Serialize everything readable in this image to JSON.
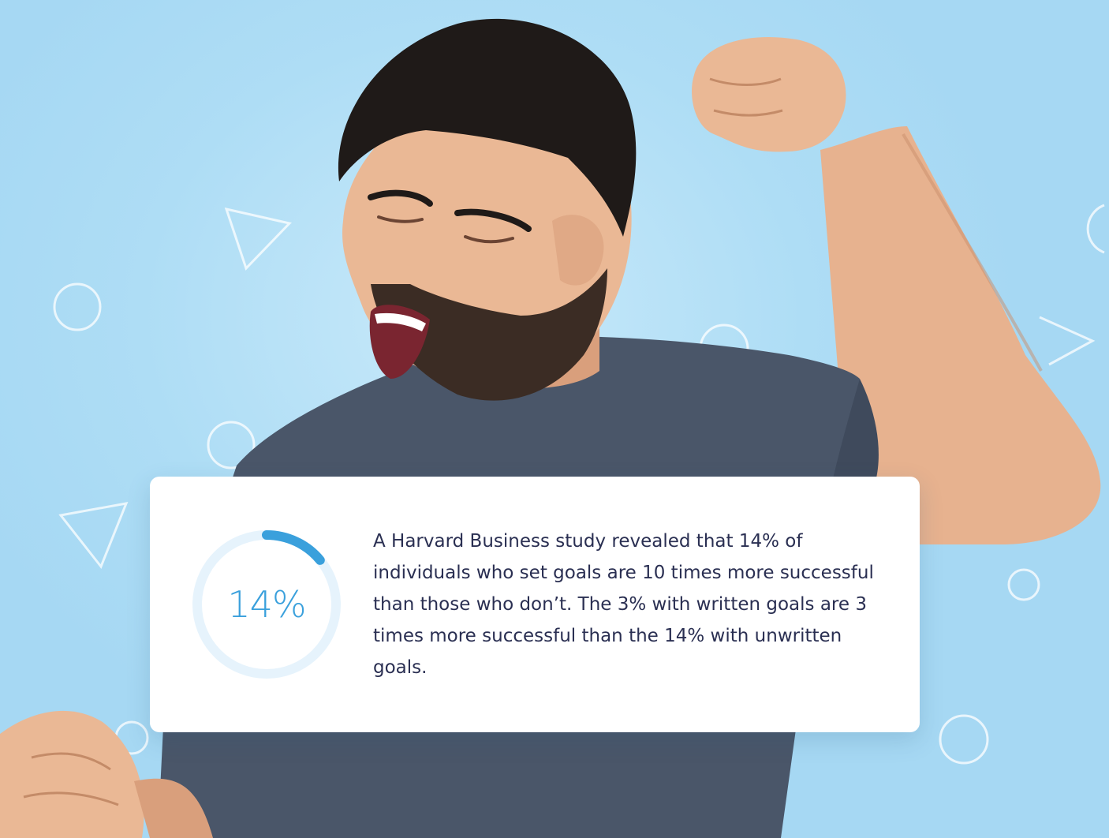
{
  "stat_card": {
    "progress_label": "14%",
    "progress_fraction": 0.14,
    "description": "A Harvard Business study revealed that 14% of individuals who set goals are 10 times more successful than those who don’t. The 3% with written goals are 3 times more successful than the 14% with unwritten goals."
  },
  "colors": {
    "background": "#aeddf5",
    "accent": "#3aa0dc",
    "ring_track": "#e6f3fc",
    "text": "#2a2f52"
  },
  "icons": [
    "hero-photo",
    "triangle-outline-icon",
    "circle-outline-icon"
  ]
}
